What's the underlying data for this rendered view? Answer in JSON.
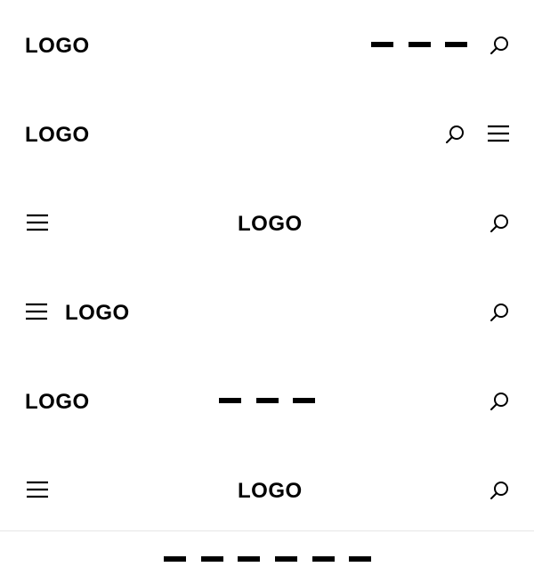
{
  "colors": {
    "foreground": "#000000",
    "background": "#ffffff",
    "divider": "#e6e6e6"
  },
  "header_variants": [
    {
      "logo": "LOGO",
      "nav_items": 3,
      "icons": [
        "search-icon"
      ]
    },
    {
      "logo": "LOGO",
      "nav_items": 0,
      "icons": [
        "search-icon",
        "hamburger-menu-icon"
      ]
    },
    {
      "logo": "LOGO",
      "nav_items": 0,
      "icons": [
        "hamburger-menu-icon",
        "search-icon"
      ]
    },
    {
      "logo": "LOGO",
      "nav_items": 0,
      "icons": [
        "hamburger-menu-icon",
        "search-icon"
      ]
    },
    {
      "logo": "LOGO",
      "nav_items": 3,
      "icons": [
        "search-icon"
      ]
    },
    {
      "logo": "LOGO",
      "nav_items": 0,
      "icons": [
        "hamburger-menu-icon",
        "search-icon"
      ]
    }
  ],
  "bottom_nav": {
    "nav_items": 6
  }
}
